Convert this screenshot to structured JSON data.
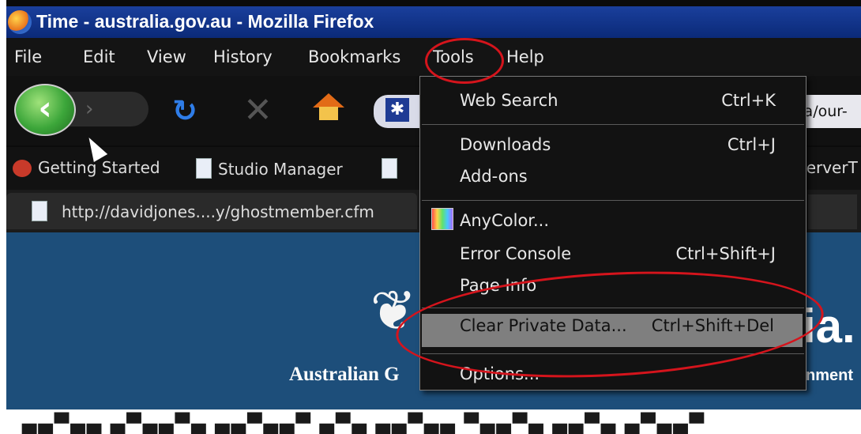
{
  "window": {
    "title": "Time - australia.gov.au - Mozilla Firefox"
  },
  "menubar": {
    "items": [
      "File",
      "Edit",
      "View",
      "History",
      "Bookmarks",
      "Tools",
      "Help"
    ]
  },
  "navbar": {
    "url_tail": "lia/our-"
  },
  "bookmarks": {
    "items": [
      "Getting Started",
      "Studio Manager"
    ],
    "right_text": "ServerT"
  },
  "tab": {
    "label": "http://davidjones....y/ghostmember.cfm"
  },
  "tools_menu": {
    "items": [
      {
        "label": "Web Search",
        "shortcut": "Ctrl+K"
      },
      {
        "label": "Downloads",
        "shortcut": "Ctrl+J"
      },
      {
        "label": "Add-ons",
        "shortcut": ""
      },
      {
        "label": "AnyColor...",
        "shortcut": ""
      },
      {
        "label": "Error Console",
        "shortcut": "Ctrl+Shift+J"
      },
      {
        "label": "Page Info",
        "shortcut": ""
      },
      {
        "label": "Clear Private Data...",
        "shortcut": "Ctrl+Shift+Del"
      },
      {
        "label": "Options...",
        "shortcut": ""
      }
    ],
    "highlighted": "Clear Private Data..."
  },
  "page": {
    "site_left": "Australian G",
    "site_right": "nment",
    "big_letters": "ia."
  },
  "colors": {
    "annotation": "#d5141c",
    "titlebar": "#1a3f9c",
    "page_bg": "#1d4e7a"
  }
}
